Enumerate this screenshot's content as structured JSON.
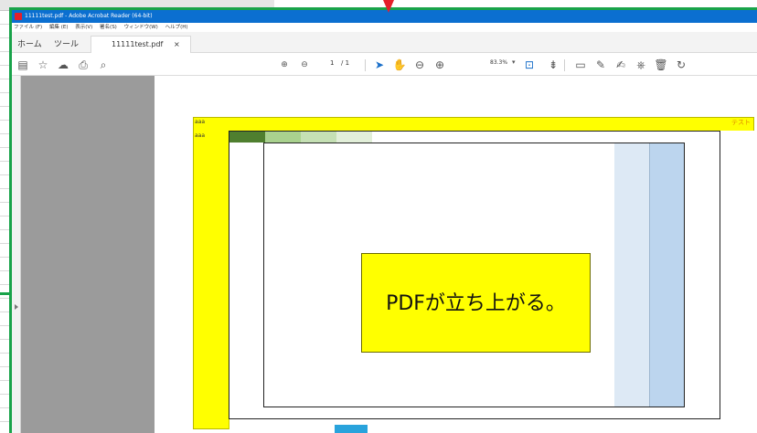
{
  "window": {
    "title": "11111test.pdf - Adobe Acrobat Reader (64-bit)"
  },
  "menu": {
    "items": [
      "ファイル (F)",
      "編集 (E)",
      "表示(V)",
      "署名(S)",
      "ウィンドウ(W)",
      "ヘルプ(H)"
    ]
  },
  "tabs": {
    "home": "ホーム",
    "tools": "ツール",
    "file": "11111test.pdf",
    "close_glyph": "×"
  },
  "toolbar": {
    "page_current": "1",
    "page_total": "/ 1",
    "zoom": "83.3%",
    "icons": [
      "save-icon",
      "bookmark-star-icon",
      "upload-cloud-icon",
      "print-icon",
      "search-zoom-icon",
      "page-up-icon",
      "page-down-icon",
      "select-cursor-icon",
      "hand-icon",
      "zoom-out-icon",
      "zoom-in-icon",
      "fit-page-icon",
      "scroll-mode-icon",
      "comment-icon",
      "highlight-pen-icon",
      "sign-icon",
      "stamp-icon",
      "delete-icon",
      "rotate-icon"
    ]
  },
  "document": {
    "cell_a1": "aaa",
    "cell_a2": "aaa",
    "header_right": "テスト",
    "callout_text": "PDFが立ち上がる。"
  },
  "colors": {
    "title_bar": "#0b6fd0",
    "annotation_frame": "#19a34a",
    "annotation_arrow": "#e4202b",
    "sheet_yellow": "#ffff00",
    "strip": [
      "#4f7f2f",
      "#a9d18e",
      "#c5e0b4",
      "#e2efd9"
    ],
    "column_light": "#dde9f5",
    "column_mid": "#bcd5ee"
  }
}
